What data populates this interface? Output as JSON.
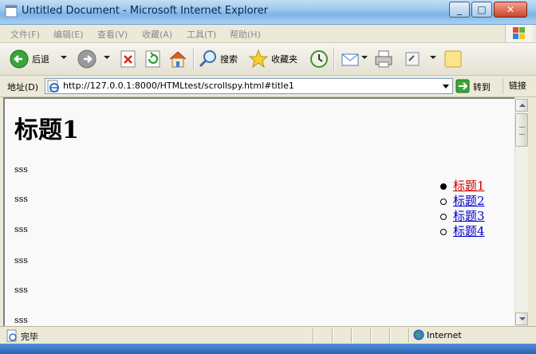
{
  "window": {
    "title": "Untitled Document - Microsoft Internet Explorer",
    "buttons": {
      "minimize": "_",
      "maximize": "□",
      "close": "✕"
    }
  },
  "menu": {
    "items": [
      "文件(F)",
      "编辑(E)",
      "查看(V)",
      "收藏(A)",
      "工具(T)",
      "帮助(H)"
    ]
  },
  "toolbar": {
    "back_label": "后退",
    "search_label": "搜索",
    "favorites_label": "收藏夹"
  },
  "address": {
    "label": "地址(D)",
    "url": "http://127.0.0.1:8000/HTMLtest/scrollspy.html#title1",
    "go_label": "转到",
    "links_label": "链接"
  },
  "page": {
    "heading": "标题1",
    "paragraphs": [
      "sss",
      "sss",
      "sss",
      "sss",
      "sss",
      "sss"
    ],
    "nav": [
      {
        "label": "标题1",
        "active": true
      },
      {
        "label": "标题2",
        "active": false
      },
      {
        "label": "标题3",
        "active": false
      },
      {
        "label": "标题4",
        "active": false
      }
    ]
  },
  "status": {
    "text": "完毕",
    "zone": "Internet"
  },
  "colors": {
    "active_link": "#cc0000",
    "link": "#0000cc",
    "page_bg": "#f9f9f9"
  }
}
